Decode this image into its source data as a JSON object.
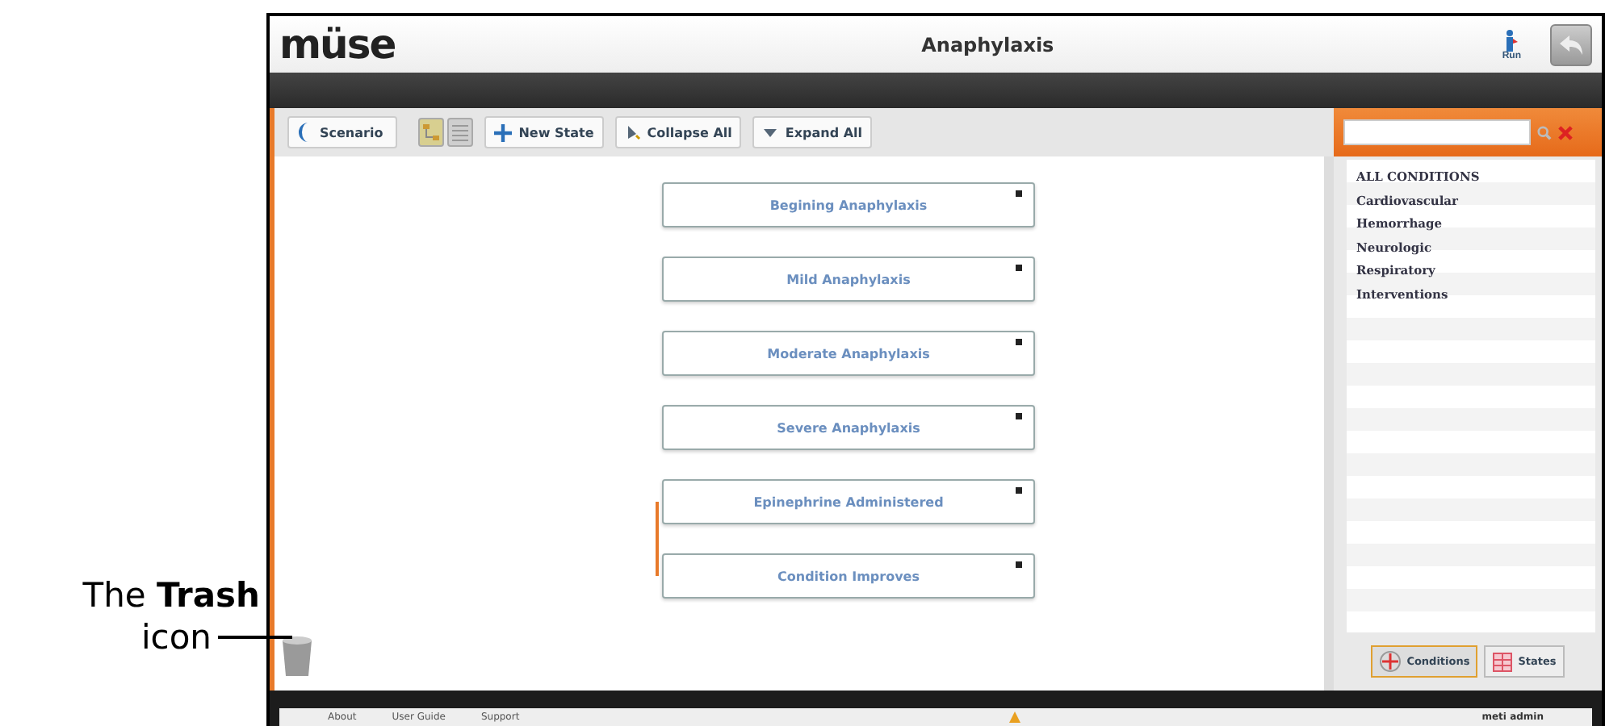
{
  "annotation": {
    "lines": [
      "The **Trash**",
      "icon"
    ]
  },
  "header": {
    "logo": "müse",
    "title": "Anaphylaxis",
    "run_label": "Run"
  },
  "toolbar": {
    "scenario": "Scenario",
    "views": [
      {
        "kind": "graph",
        "selected": true
      },
      {
        "kind": "list",
        "selected": false
      }
    ],
    "buttons": [
      {
        "kind": "plus",
        "label": "New State"
      },
      {
        "kind": "collapse",
        "label": "Collapse All"
      },
      {
        "kind": "expand",
        "label": "Expand All"
      }
    ]
  },
  "states": [
    {
      "label": "Begining Anaphylaxis",
      "linked_to_next": false
    },
    {
      "label": "Mild Anaphylaxis",
      "linked_to_next": false
    },
    {
      "label": "Moderate Anaphylaxis",
      "linked_to_next": false
    },
    {
      "label": "Severe Anaphylaxis",
      "linked_to_next": false
    },
    {
      "label": "Epinephrine Administered",
      "linked_to_next": true
    },
    {
      "label": "Condition Improves",
      "linked_to_next": false
    }
  ],
  "sidebar": {
    "conditions": [
      "ALL CONDITIONS",
      "Cardiovascular",
      "Hemorrhage",
      "Neurologic",
      "Respiratory",
      "Interventions"
    ],
    "tabs": [
      {
        "label": "Conditions",
        "selected": true
      },
      {
        "label": "States",
        "selected": false
      }
    ]
  },
  "footer": {
    "links": [
      "About",
      "User Guide",
      "Support"
    ],
    "user": "meti admin"
  }
}
